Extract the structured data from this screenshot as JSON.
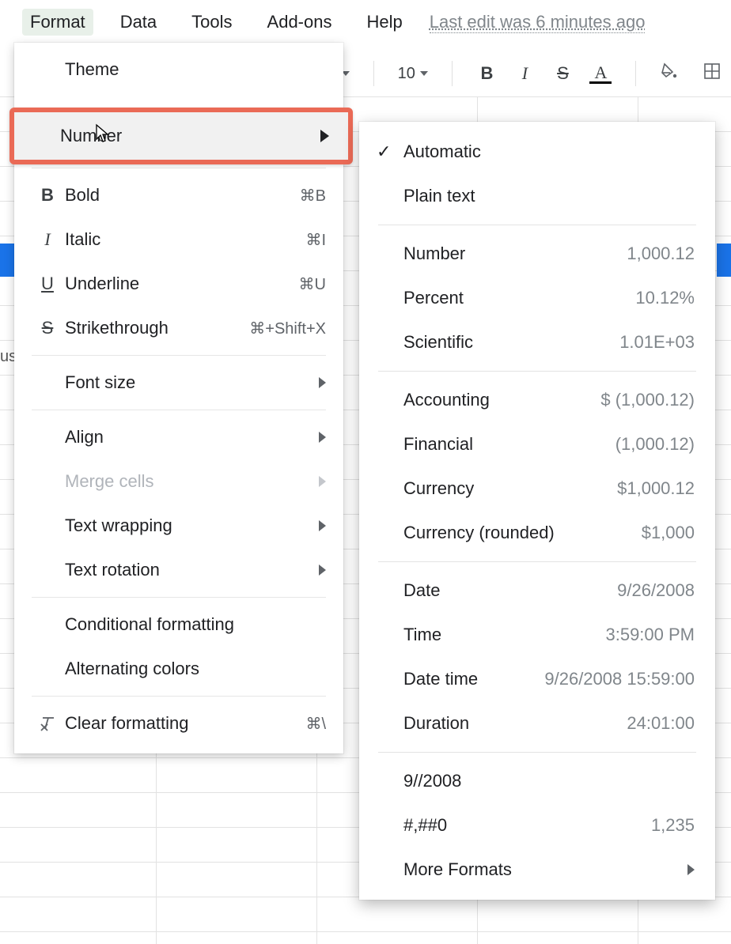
{
  "menubar": {
    "items": [
      "Format",
      "Data",
      "Tools",
      "Add-ons",
      "Help"
    ],
    "active_index": 0,
    "last_edit": "Last edit was 6 minutes ago"
  },
  "toolbar": {
    "font_size": "10",
    "buttons": {
      "bold": "B",
      "italic": "I",
      "strike": "S",
      "textcolor": "A"
    }
  },
  "format_menu": {
    "theme": "Theme",
    "number": "Number",
    "bold": {
      "label": "Bold",
      "shortcut": "⌘B"
    },
    "italic": {
      "label": "Italic",
      "shortcut": "⌘I"
    },
    "underline": {
      "label": "Underline",
      "shortcut": "⌘U"
    },
    "strike": {
      "label": "Strikethrough",
      "shortcut": "⌘+Shift+X"
    },
    "font_size": "Font size",
    "align": "Align",
    "merge": "Merge cells",
    "wrap": "Text wrapping",
    "rotate": "Text rotation",
    "cond": "Conditional formatting",
    "altcolors": "Alternating colors",
    "clear": {
      "label": "Clear formatting",
      "shortcut": "⌘\\"
    }
  },
  "number_submenu": {
    "automatic": "Automatic",
    "plain": "Plain text",
    "number": {
      "label": "Number",
      "example": "1,000.12"
    },
    "percent": {
      "label": "Percent",
      "example": "10.12%"
    },
    "scientific": {
      "label": "Scientific",
      "example": "1.01E+03"
    },
    "accounting": {
      "label": "Accounting",
      "example": "$ (1,000.12)"
    },
    "financial": {
      "label": "Financial",
      "example": "(1,000.12)"
    },
    "currency": {
      "label": "Currency",
      "example": "$1,000.12"
    },
    "currency_rounded": {
      "label": "Currency (rounded)",
      "example": "$1,000"
    },
    "date": {
      "label": "Date",
      "example": "9/26/2008"
    },
    "time": {
      "label": "Time",
      "example": "3:59:00 PM"
    },
    "datetime": {
      "label": "Date time",
      "example": "9/26/2008 15:59:00"
    },
    "duration": {
      "label": "Duration",
      "example": "24:01:00"
    },
    "custom1": {
      "label": "9//2008",
      "example": ""
    },
    "custom2": {
      "label": "#,##0",
      "example": "1,235"
    },
    "more": "More Formats"
  },
  "stray": {
    "us": "us"
  }
}
